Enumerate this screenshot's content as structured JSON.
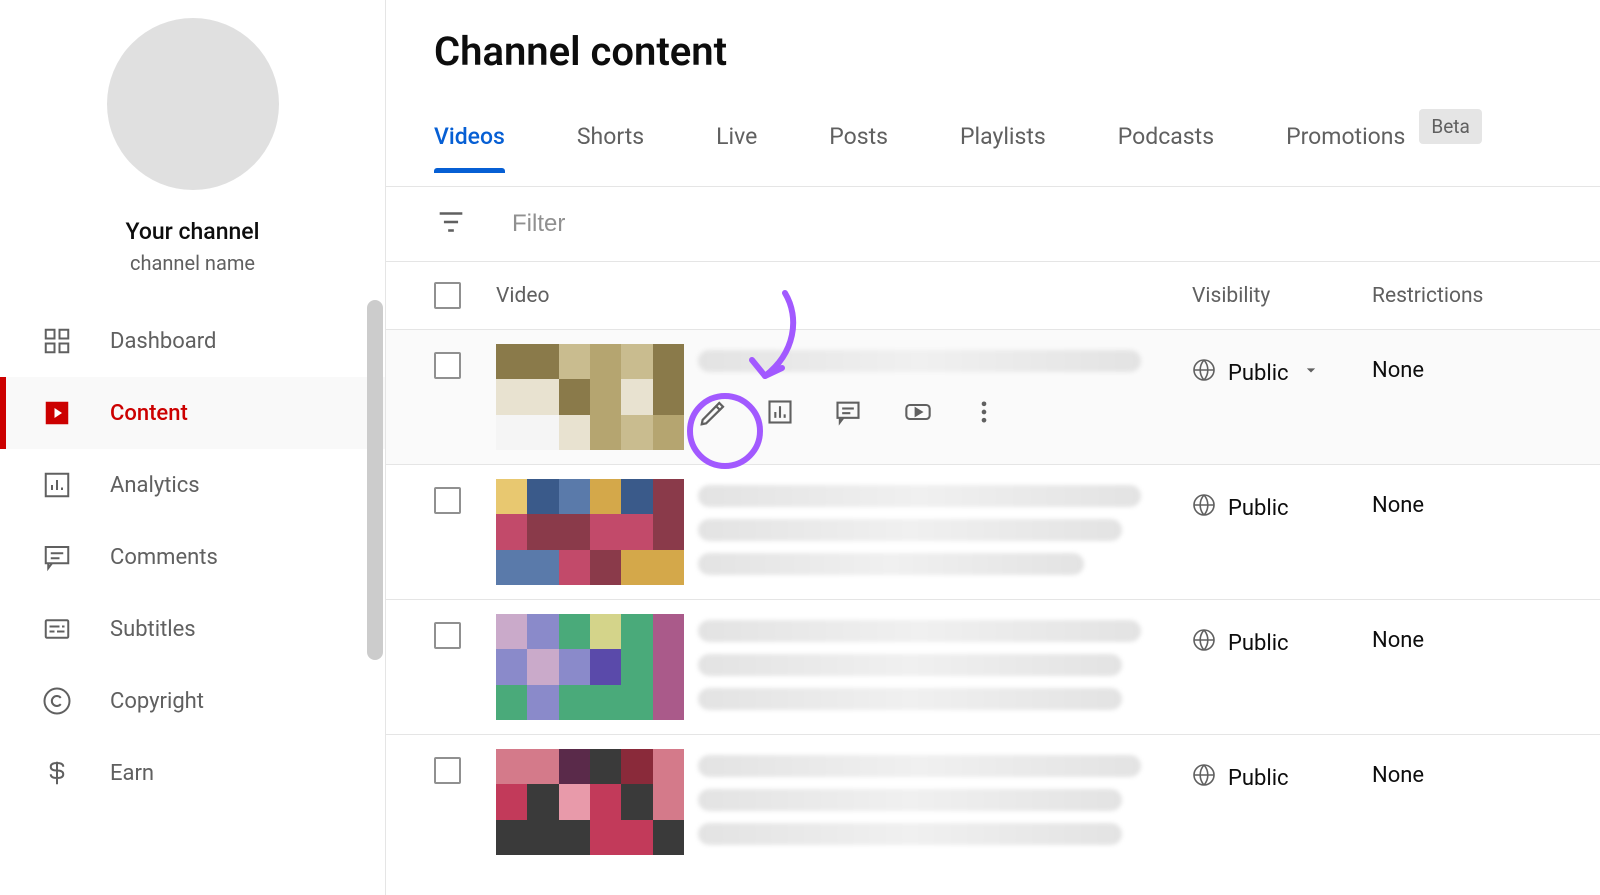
{
  "sidebar": {
    "profile_title": "Your channel",
    "profile_sub": "channel name",
    "items": [
      {
        "label": "Dashboard"
      },
      {
        "label": "Content"
      },
      {
        "label": "Analytics"
      },
      {
        "label": "Comments"
      },
      {
        "label": "Subtitles"
      },
      {
        "label": "Copyright"
      },
      {
        "label": "Earn"
      }
    ],
    "active_index": 1
  },
  "page": {
    "title": "Channel content"
  },
  "tabs": {
    "items": [
      "Videos",
      "Shorts",
      "Live",
      "Posts",
      "Playlists",
      "Podcasts",
      "Promotions"
    ],
    "beta_label": "Beta",
    "active_index": 0
  },
  "filter": {
    "placeholder": "Filter"
  },
  "table": {
    "headers": {
      "video": "Video",
      "visibility": "Visibility",
      "restrictions": "Restrictions"
    },
    "rows": [
      {
        "visibility": "Public",
        "restrictions": "None",
        "hovered": true,
        "has_dropdown": true
      },
      {
        "visibility": "Public",
        "restrictions": "None",
        "hovered": false,
        "has_dropdown": false
      },
      {
        "visibility": "Public",
        "restrictions": "None",
        "hovered": false,
        "has_dropdown": false
      },
      {
        "visibility": "Public",
        "restrictions": "None",
        "hovered": false,
        "has_dropdown": false
      }
    ]
  },
  "annotation": {
    "highlight": "edit-pencil-icon"
  }
}
